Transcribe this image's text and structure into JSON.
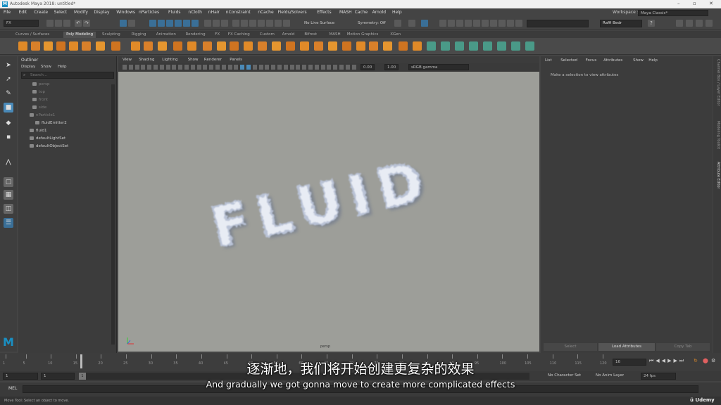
{
  "app": {
    "window_title": "Autodesk Maya 2018: untitled*",
    "logo_letter": "M"
  },
  "menus": [
    "File",
    "Edit",
    "Create",
    "Select",
    "Modify",
    "Display",
    "Windows",
    "nParticles",
    "Fluids",
    "nCloth",
    "nHair",
    "nConstraint",
    "nCache",
    "Fields/Solvers",
    "Effects",
    "MASH",
    "Cache",
    "Arnold",
    "Help"
  ],
  "workspace": {
    "label": "Workspace :",
    "value": "Maya Classic*"
  },
  "status": {
    "mode": "FX",
    "live_surface": "No Live Surface",
    "symmetry": "Symmetry: Off",
    "user": "Raffi Bedr"
  },
  "shelf_tabs": [
    "Curves / Surfaces",
    "Poly Modeling",
    "Sculpting",
    "Rigging",
    "Animation",
    "Rendering",
    "FX",
    "FX Caching",
    "Custom",
    "Arnold",
    "Bifrost",
    "MASH",
    "Motion Graphics",
    "XGen"
  ],
  "active_shelf_tab": "Poly Modeling",
  "outliner": {
    "title": "Outliner",
    "menu": [
      "Display",
      "Show",
      "Help"
    ],
    "search_placeholder": "Search...",
    "items": [
      {
        "label": "persp",
        "dim": true
      },
      {
        "label": "top",
        "dim": true
      },
      {
        "label": "front",
        "dim": true
      },
      {
        "label": "side",
        "dim": true
      },
      {
        "label": "nParticle1",
        "dim": true
      },
      {
        "label": "fluidEmitter2",
        "dim": false
      },
      {
        "label": "fluid1",
        "dim": false
      },
      {
        "label": "defaultLightSet",
        "dim": false
      },
      {
        "label": "defaultObjectSet",
        "dim": false
      }
    ]
  },
  "viewport": {
    "menu": [
      "View",
      "Shading",
      "Lighting",
      "Show",
      "Renderer",
      "Panels"
    ],
    "exposure": "0.00",
    "gamma": "1.00",
    "color_space": "sRGB gamma",
    "camera_label": "persp",
    "fluid_text": "FLUID"
  },
  "attribute_editor": {
    "menu": [
      "List",
      "Selected",
      "Focus",
      "Attributes",
      "Show",
      "Help"
    ],
    "message": "Make a selection to view attributes",
    "buttons": [
      "Select",
      "Load Attributes",
      "Copy Tab"
    ]
  },
  "side_tabs": [
    "Channel Box / Layer Editor",
    "Modeling Toolkit",
    "Attribute Editor"
  ],
  "timeline": {
    "ticks": [
      "1",
      "5",
      "10",
      "15",
      "20",
      "25",
      "30",
      "35",
      "40",
      "45",
      "50",
      "55",
      "60",
      "65",
      "70",
      "75",
      "80",
      "85",
      "90",
      "95",
      "100",
      "105",
      "110",
      "115",
      "120"
    ],
    "current_frame": "16",
    "playhead_frame": 16,
    "max_frame": 120,
    "range_start": "1",
    "range_inner_start": "1",
    "range_marker": "1",
    "char_set": "No Character Set",
    "anim_layer": "No Anim Layer",
    "fps": "24 fps"
  },
  "command": {
    "lang": "MEL"
  },
  "help_line": "Move Tool: Select an object to move.",
  "subtitles": {
    "cn": "逐渐地，我们将开始创建更复杂的效果",
    "en": "And gradually we got gonna move to create more complicated effects"
  },
  "watermark": "Udemy",
  "colors": {
    "maya_blue": "#1a8fc2",
    "shelf_orange": "#e08a28",
    "highlight_blue": "#4a8ab8"
  }
}
